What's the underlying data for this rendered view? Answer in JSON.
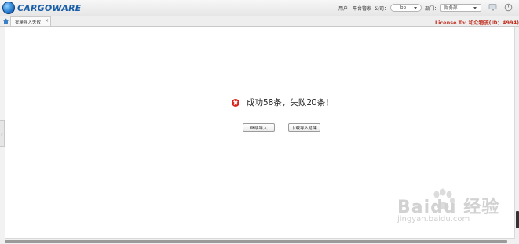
{
  "header": {
    "brand": "CARGOWARE",
    "user_label": "用户：",
    "user_value": "平台管家",
    "company_label": "公司：",
    "company_value": "bb",
    "dept_label": "部门：",
    "dept_value": "财务部"
  },
  "tabs": [
    {
      "label": "批量导入失败"
    }
  ],
  "license": "License To: 和众物流(ID：4994)",
  "result": {
    "message": "成功58条，失败20条！",
    "continue_label": "继续导入",
    "download_label": "下载导入结果"
  },
  "watermark": {
    "main": "Baidu 经验",
    "sub": "jingyan.baidu.com"
  },
  "colors": {
    "error": "#d9231b",
    "license": "#c03020",
    "brand": "#1b5ea8"
  },
  "icons": [
    "globe-logo-icon",
    "monitor-icon",
    "power-icon",
    "home-icon",
    "error-icon",
    "chevron-right-icon"
  ]
}
